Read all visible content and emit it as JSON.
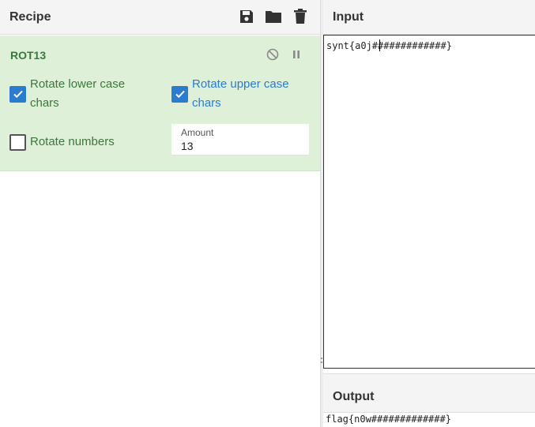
{
  "recipe": {
    "title": "Recipe",
    "icons": [
      "save-icon",
      "folder-icon",
      "trash-icon"
    ]
  },
  "operation": {
    "name": "ROT13",
    "controls": [
      "disable-icon",
      "pause-icon"
    ],
    "options": {
      "rotate_lower": {
        "label": "Rotate lower case chars",
        "checked": true
      },
      "rotate_upper": {
        "label": "Rotate upper case chars",
        "checked": true
      },
      "rotate_numbers": {
        "label": "Rotate numbers",
        "checked": false
      }
    },
    "amount": {
      "label": "Amount",
      "value": "13"
    }
  },
  "input": {
    "title": "Input",
    "text": "synt{a0j#############}"
  },
  "output": {
    "title": "Output",
    "text": "flag{n0w#############}"
  },
  "colors": {
    "accent": "#2b7bd1",
    "op_background": "#dff0d8",
    "op_text": "#3c763d"
  }
}
